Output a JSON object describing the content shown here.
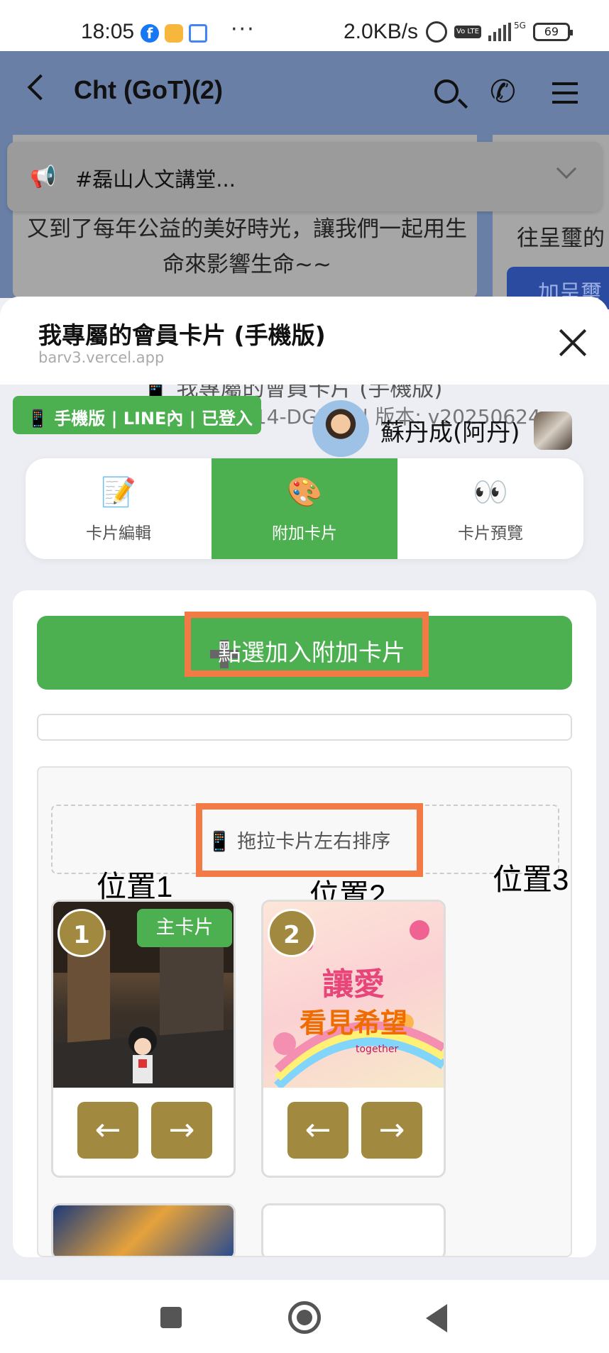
{
  "status_bar": {
    "time": "18:05",
    "speed": "2.0KB/s",
    "network": "5G",
    "battery": "69",
    "volte": "Vo LTE",
    "fb_letter": "f",
    "dots": "···"
  },
  "chat": {
    "title": "Cht (GoT)(2)",
    "announcement": "#磊山人文講堂...",
    "bubble_text": "又到了每年公益的美好時光，讓我們一起用生命來影響生命~~",
    "right_bubble_text": "往呈璽的",
    "right_bubble_button": "加呈璽"
  },
  "sheet": {
    "title": "我專屬的會員卡片 (手機版)",
    "url": "barv3.vercel.app"
  },
  "page": {
    "title": "📱 我專屬的會員卡片 (手機版)",
    "subtitle": "914-DGI  Nk | 版本: v20250624",
    "login_badge": "📱 手機版 | LINE內 | 已登入",
    "user_name": "蘇丹成(阿丹)"
  },
  "tabs": [
    {
      "icon": "📝",
      "label": "卡片編輯"
    },
    {
      "icon": "🎨",
      "label": "附加卡片"
    },
    {
      "icon": "👀",
      "label": "卡片預覽"
    }
  ],
  "add_button_label": "點選加入附加卡片",
  "drag_hint": "📱 拖拉卡片左右排序",
  "positions": [
    "位置1",
    "位置2",
    "位置3"
  ],
  "cards": [
    {
      "number": "1",
      "badge": "主卡片"
    },
    {
      "number": "2",
      "badge": ""
    }
  ],
  "card2_text": {
    "line1": "讓愛",
    "line2": "看見希望",
    "brand": "together"
  },
  "arrows": {
    "left": "←",
    "right": "→"
  },
  "colors": {
    "accent_green": "#4caf50",
    "gold": "#a18a3f",
    "annotation_orange": "#f47a45",
    "line_blue": "#2b4ba0"
  }
}
